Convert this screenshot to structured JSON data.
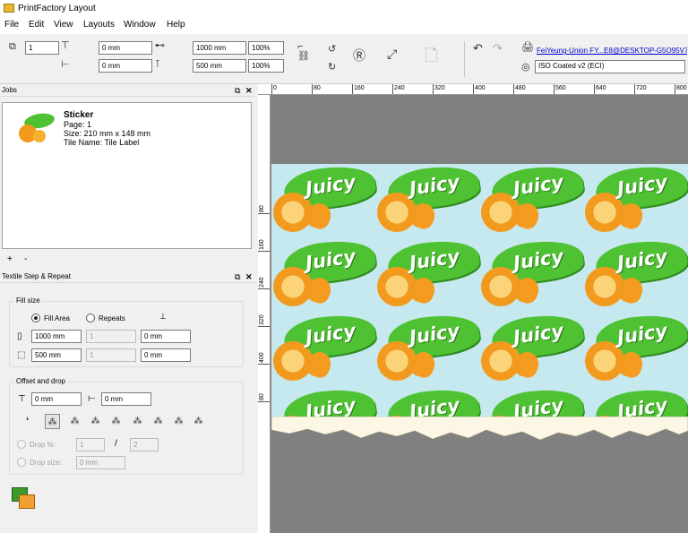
{
  "window": {
    "title": "PrintFactory Layout"
  },
  "menu": [
    "File",
    "Edit",
    "View",
    "Layouts",
    "Window",
    "Help"
  ],
  "toolbar": {
    "copies": "1",
    "offset_x": "0 mm",
    "offset_y": "0 mm",
    "width": "1000 mm",
    "height": "500 mm",
    "width_pct": "100%",
    "height_pct": "100%",
    "printer": "FeiYeung-Union FY...E8@DESKTOP-G5O95V7",
    "profile": "ISO Coated v2 (ECI)"
  },
  "jobs": {
    "panel_title": "Jobs",
    "job": {
      "name": "Sticker",
      "page": "Page: 1",
      "size": "Size: 210 mm x 148 mm",
      "tile_name": "Tile Name: Tile Label"
    },
    "add_label": "+",
    "remove_label": "-"
  },
  "step_repeat": {
    "panel_title": "Textile Step & Repeat",
    "fill_size_title": "Fill size",
    "fill_area_label": "Fill Area",
    "repeats_label": "Repeats",
    "width": "1000 mm",
    "width_repeats": "1",
    "width_gap": "0 mm",
    "height": "500 mm",
    "height_repeats": "1",
    "height_gap": "0 mm",
    "offset_title": "Offset and drop",
    "offset_x": "0 mm",
    "offset_y": "0 mm",
    "drop_pct_label": "Drop %:",
    "drop_num": "1",
    "drop_slash": "/",
    "drop_den": "2",
    "drop_size_label": "Drop size:",
    "drop_size": "0 mm"
  },
  "rulers": {
    "top": [
      "0",
      "80",
      "160",
      "240",
      "320",
      "400",
      "480",
      "560",
      "640",
      "720",
      "800"
    ],
    "left": [
      "80",
      "160",
      "240",
      "320",
      "400",
      "80"
    ]
  },
  "artwork": {
    "label": "Juicy"
  }
}
